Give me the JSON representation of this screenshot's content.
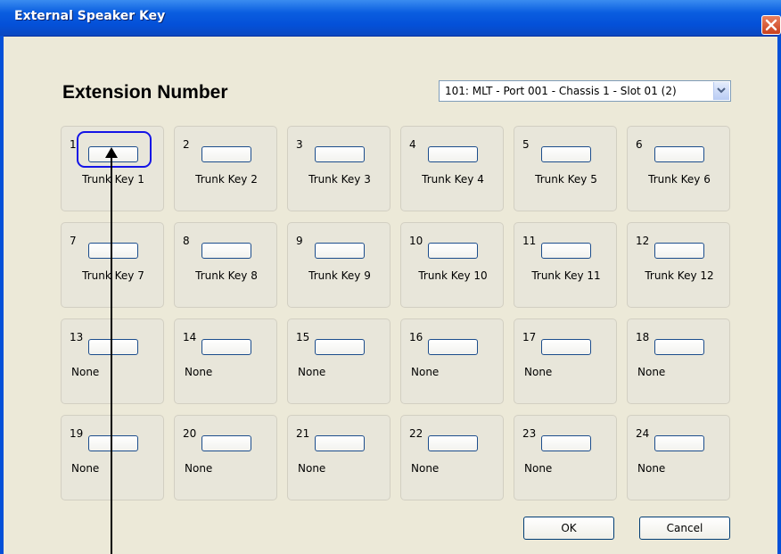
{
  "window": {
    "title": "External Speaker Key"
  },
  "heading": "Extension Number",
  "extension_select": {
    "value": "101: MLT - Port 001 - Chassis 1 - Slot 01 (2)"
  },
  "keys": [
    {
      "num": "1",
      "label": "Trunk Key 1"
    },
    {
      "num": "2",
      "label": "Trunk Key 2"
    },
    {
      "num": "3",
      "label": "Trunk Key 3"
    },
    {
      "num": "4",
      "label": "Trunk Key 4"
    },
    {
      "num": "5",
      "label": "Trunk Key 5"
    },
    {
      "num": "6",
      "label": "Trunk Key 6"
    },
    {
      "num": "7",
      "label": "Trunk Key 7"
    },
    {
      "num": "8",
      "label": "Trunk Key 8"
    },
    {
      "num": "9",
      "label": "Trunk Key 9"
    },
    {
      "num": "10",
      "label": "Trunk Key 10"
    },
    {
      "num": "11",
      "label": "Trunk Key 11"
    },
    {
      "num": "12",
      "label": "Trunk Key 12"
    },
    {
      "num": "13",
      "label": "None"
    },
    {
      "num": "14",
      "label": "None"
    },
    {
      "num": "15",
      "label": "None"
    },
    {
      "num": "16",
      "label": "None"
    },
    {
      "num": "17",
      "label": "None"
    },
    {
      "num": "18",
      "label": "None"
    },
    {
      "num": "19",
      "label": "None"
    },
    {
      "num": "20",
      "label": "None"
    },
    {
      "num": "21",
      "label": "None"
    },
    {
      "num": "22",
      "label": "None"
    },
    {
      "num": "23",
      "label": "None"
    },
    {
      "num": "24",
      "label": "None"
    }
  ],
  "buttons": {
    "ok": "OK",
    "cancel": "Cancel"
  },
  "icons": {
    "close": "close-icon",
    "dropdown": "chevron-down-icon"
  },
  "colors": {
    "titlebar": "#0a5ee0",
    "highlight": "#1414e6",
    "key_border": "#1c4d8c"
  }
}
